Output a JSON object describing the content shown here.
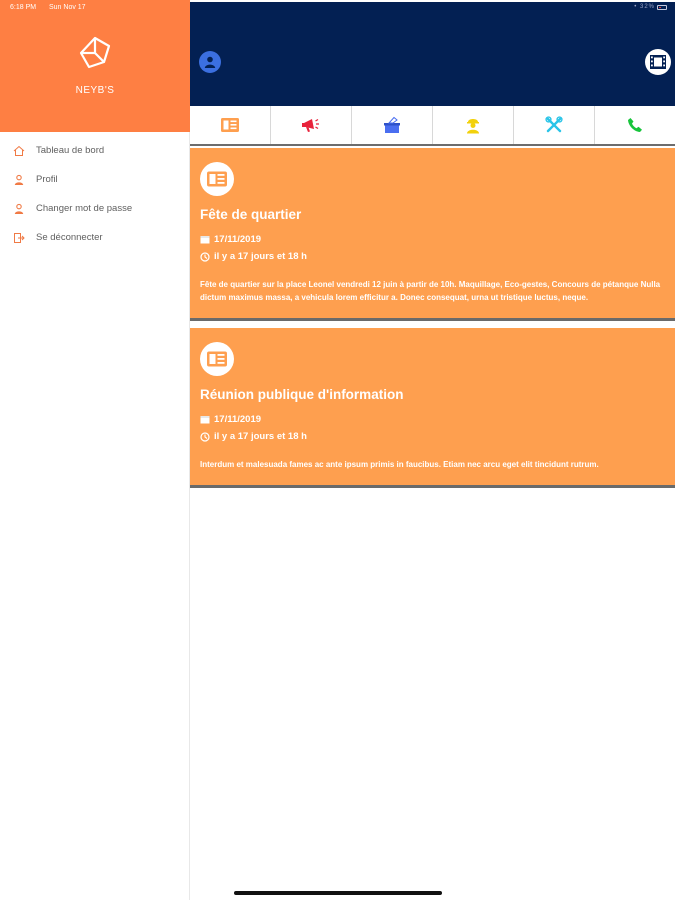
{
  "status_bar": {
    "time": "6:18 PM",
    "date": "Sun Nov 17",
    "right": "• 32%"
  },
  "sidebar": {
    "brand": "NEYB'S",
    "items": [
      {
        "label": "Tableau de bord",
        "icon": "home-icon"
      },
      {
        "label": "Profil",
        "icon": "user-icon"
      },
      {
        "label": "Changer mot de passe",
        "icon": "user-icon"
      },
      {
        "label": "Se déconnecter",
        "icon": "logout-icon"
      }
    ]
  },
  "tabs": [
    {
      "icon": "news-icon",
      "color": "#fe9f4f"
    },
    {
      "icon": "megaphone-icon",
      "color": "#e8233b"
    },
    {
      "icon": "vote-icon",
      "color": "#4a6ef0"
    },
    {
      "icon": "worker-icon",
      "color": "#f2d10c"
    },
    {
      "icon": "tools-icon",
      "color": "#29c4e8"
    },
    {
      "icon": "phone-icon",
      "color": "#18c43c"
    }
  ],
  "cards": [
    {
      "title": "Fête de quartier",
      "date": "17/11/2019",
      "ago": "il y a 17 jours et 18 h",
      "description": "Fête de quartier sur la place Leonel vendredi 12 juin à partir de 10h. Maquillage, Eco-gestes, Concours de pétanque Nulla dictum maximus massa, a vehicula lorem efficitur a. Donec consequat, urna ut tristique luctus, neque."
    },
    {
      "title": "Réunion publique d'information",
      "date": "17/11/2019",
      "ago": "il y a 17 jours et 18 h",
      "description": "Interdum et malesuada fames ac ante ipsum primis in faucibus. Etiam nec arcu eget elit tincidunt rutrum."
    }
  ],
  "colors": {
    "sidebar_header": "#fe7f43",
    "header": "#032053",
    "card": "#fe9f4f",
    "accent": "#fe7f43"
  }
}
